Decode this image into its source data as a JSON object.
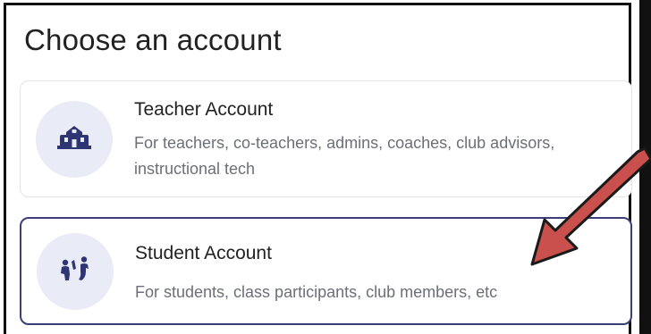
{
  "page": {
    "title": "Choose an account"
  },
  "accounts": [
    {
      "title": "Teacher Account",
      "description": "For teachers, co-teachers, admins, coaches, club advisors, instructional tech",
      "icon": "school-building-icon"
    },
    {
      "title": "Student Account",
      "description": "For students, class participants, club members, etc",
      "icon": "students-group-icon"
    }
  ],
  "colors": {
    "icon_color": "#2f3472",
    "avatar_bg": "#e9ebf7",
    "selected_border": "#3a3f78",
    "arrow_fill": "#c9504c"
  }
}
